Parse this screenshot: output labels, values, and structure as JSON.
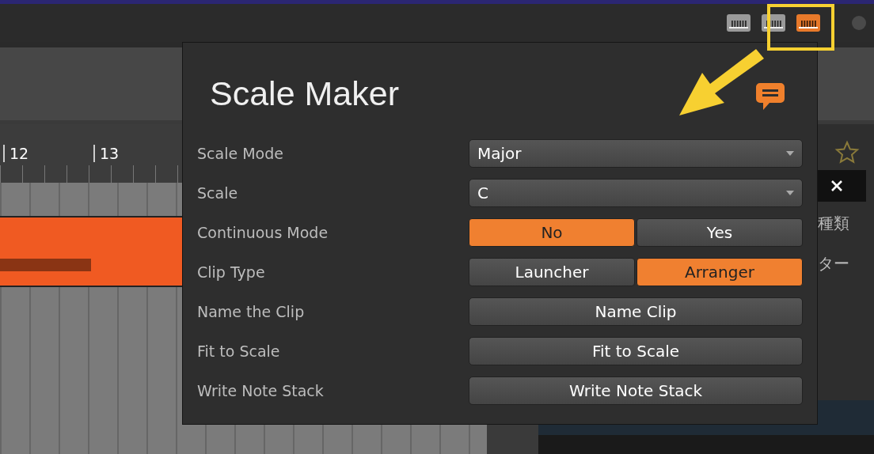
{
  "header": {
    "piano_buttons": [
      {
        "selected": false
      },
      {
        "selected": false
      },
      {
        "selected": true
      }
    ]
  },
  "ruler": {
    "labels": [
      "12",
      "13"
    ]
  },
  "browser_panel": {
    "texts": [
      "種類",
      "ター"
    ]
  },
  "dialog": {
    "title": "Scale Maker",
    "rows": [
      {
        "label": "Scale Mode",
        "kind": "dropdown",
        "value": "Major"
      },
      {
        "label": "Scale",
        "kind": "dropdown",
        "value": "C"
      },
      {
        "label": "Continuous Mode",
        "kind": "toggle",
        "options": [
          {
            "label": "No",
            "selected": true
          },
          {
            "label": "Yes",
            "selected": false
          }
        ]
      },
      {
        "label": "Clip Type",
        "kind": "toggle",
        "options": [
          {
            "label": "Launcher",
            "selected": false
          },
          {
            "label": "Arranger",
            "selected": true
          }
        ]
      },
      {
        "label": "Name the Clip",
        "kind": "button",
        "value": "Name Clip"
      },
      {
        "label": "Fit to Scale",
        "kind": "button",
        "value": "Fit to Scale"
      },
      {
        "label": "Write Note Stack",
        "kind": "button",
        "value": "Write Note Stack"
      }
    ]
  }
}
